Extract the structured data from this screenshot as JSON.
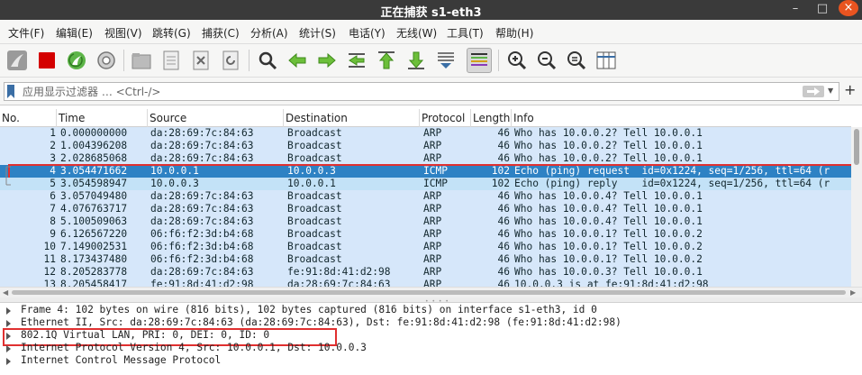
{
  "window": {
    "title": "正在捕获 s1-eth3"
  },
  "window_controls": {
    "minimize": "–",
    "maximize": "□",
    "close": "×"
  },
  "menu": [
    {
      "label": "文件(F)"
    },
    {
      "label": "编辑(E)"
    },
    {
      "label": "视图(V)"
    },
    {
      "label": "跳转(G)"
    },
    {
      "label": "捕获(C)"
    },
    {
      "label": "分析(A)"
    },
    {
      "label": "统计(S)"
    },
    {
      "label": "电话(Y)"
    },
    {
      "label": "无线(W)"
    },
    {
      "label": "工具(T)"
    },
    {
      "label": "帮助(H)"
    }
  ],
  "toolbar": [
    {
      "icon": "shark-fin-start-icon"
    },
    {
      "icon": "stop-capture-icon"
    },
    {
      "icon": "restart-capture-icon"
    },
    {
      "icon": "capture-options-icon"
    },
    {
      "icon": "open-file-icon"
    },
    {
      "icon": "save-file-icon"
    },
    {
      "icon": "close-file-icon"
    },
    {
      "icon": "reload-file-icon"
    },
    {
      "icon": "find-packet-icon"
    },
    {
      "icon": "go-back-icon"
    },
    {
      "icon": "go-forward-icon"
    },
    {
      "icon": "go-to-packet-icon"
    },
    {
      "icon": "first-packet-icon"
    },
    {
      "icon": "last-packet-icon"
    },
    {
      "icon": "auto-scroll-icon"
    },
    {
      "icon": "colorize-icon"
    },
    {
      "icon": "zoom-in-icon"
    },
    {
      "icon": "zoom-out-icon"
    },
    {
      "icon": "zoom-normal-icon"
    },
    {
      "icon": "resize-columns-icon"
    }
  ],
  "filter": {
    "placeholder": "应用显示过滤器 … <Ctrl-/>",
    "value": "",
    "add": "+"
  },
  "packet_list": {
    "columns": [
      "No.",
      "Time",
      "Source",
      "Destination",
      "Protocol",
      "Length",
      "Info"
    ],
    "selected_index": 3,
    "rows": [
      {
        "no": "1",
        "time": "0.000000000",
        "src": "da:28:69:7c:84:63",
        "dst": "Broadcast",
        "proto": "ARP",
        "len": "46",
        "info": "Who has 10.0.0.2? Tell 10.0.0.1",
        "kind": "arp"
      },
      {
        "no": "2",
        "time": "1.004396208",
        "src": "da:28:69:7c:84:63",
        "dst": "Broadcast",
        "proto": "ARP",
        "len": "46",
        "info": "Who has 10.0.0.2? Tell 10.0.0.1",
        "kind": "arp"
      },
      {
        "no": "3",
        "time": "2.028685068",
        "src": "da:28:69:7c:84:63",
        "dst": "Broadcast",
        "proto": "ARP",
        "len": "46",
        "info": "Who has 10.0.0.2? Tell 10.0.0.1",
        "kind": "arp"
      },
      {
        "no": "4",
        "time": "3.054471662",
        "src": "10.0.0.1",
        "dst": "10.0.0.3",
        "proto": "ICMP",
        "len": "102",
        "info": "Echo (ping) request  id=0x1224, seq=1/256, ttl=64 (r",
        "kind": "icmp"
      },
      {
        "no": "5",
        "time": "3.054598947",
        "src": "10.0.0.3",
        "dst": "10.0.0.1",
        "proto": "ICMP",
        "len": "102",
        "info": "Echo (ping) reply    id=0x1224, seq=1/256, ttl=64 (r",
        "kind": "icmp"
      },
      {
        "no": "6",
        "time": "3.057049480",
        "src": "da:28:69:7c:84:63",
        "dst": "Broadcast",
        "proto": "ARP",
        "len": "46",
        "info": "Who has 10.0.0.4? Tell 10.0.0.1",
        "kind": "arp"
      },
      {
        "no": "7",
        "time": "4.076763717",
        "src": "da:28:69:7c:84:63",
        "dst": "Broadcast",
        "proto": "ARP",
        "len": "46",
        "info": "Who has 10.0.0.4? Tell 10.0.0.1",
        "kind": "arp"
      },
      {
        "no": "8",
        "time": "5.100509063",
        "src": "da:28:69:7c:84:63",
        "dst": "Broadcast",
        "proto": "ARP",
        "len": "46",
        "info": "Who has 10.0.0.4? Tell 10.0.0.1",
        "kind": "arp"
      },
      {
        "no": "9",
        "time": "6.126567220",
        "src": "06:f6:f2:3d:b4:68",
        "dst": "Broadcast",
        "proto": "ARP",
        "len": "46",
        "info": "Who has 10.0.0.1? Tell 10.0.0.2",
        "kind": "arp"
      },
      {
        "no": "10",
        "time": "7.149002531",
        "src": "06:f6:f2:3d:b4:68",
        "dst": "Broadcast",
        "proto": "ARP",
        "len": "46",
        "info": "Who has 10.0.0.1? Tell 10.0.0.2",
        "kind": "arp"
      },
      {
        "no": "11",
        "time": "8.173437480",
        "src": "06:f6:f2:3d:b4:68",
        "dst": "Broadcast",
        "proto": "ARP",
        "len": "46",
        "info": "Who has 10.0.0.1? Tell 10.0.0.2",
        "kind": "arp"
      },
      {
        "no": "12",
        "time": "8.205283778",
        "src": "da:28:69:7c:84:63",
        "dst": "fe:91:8d:41:d2:98",
        "proto": "ARP",
        "len": "46",
        "info": "Who has 10.0.0.3? Tell 10.0.0.1",
        "kind": "arp"
      },
      {
        "no": "13",
        "time": "8.205458417",
        "src": "fe:91:8d:41:d2:98",
        "dst": "da:28:69:7c:84:63",
        "proto": "ARP",
        "len": "46",
        "info": "10.0.0.3 is at fe:91:8d:41:d2:98",
        "kind": "arp"
      }
    ]
  },
  "details": {
    "items": [
      {
        "text": "Frame 4: 102 bytes on wire (816 bits), 102 bytes captured (816 bits) on interface s1-eth3, id 0",
        "highlighted": false
      },
      {
        "text": "Ethernet II, Src: da:28:69:7c:84:63 (da:28:69:7c:84:63), Dst: fe:91:8d:41:d2:98 (fe:91:8d:41:d2:98)",
        "highlighted": false
      },
      {
        "text": "802.1Q Virtual LAN, PRI: 0, DEI: 0, ID: 0",
        "highlighted": true
      },
      {
        "text": "Internet Protocol Version 4, Src: 10.0.0.1, Dst: 10.0.0.3",
        "highlighted": false
      },
      {
        "text": "Internet Control Message Protocol",
        "highlighted": false
      }
    ]
  },
  "colors": {
    "titlebar": "#3a3a3a",
    "selected_row": "#2e82c4",
    "arp_row": "#d6e7fa",
    "icmp_row": "#c3e2f7",
    "highlight_box": "#e03030",
    "close_button": "#e95420"
  }
}
